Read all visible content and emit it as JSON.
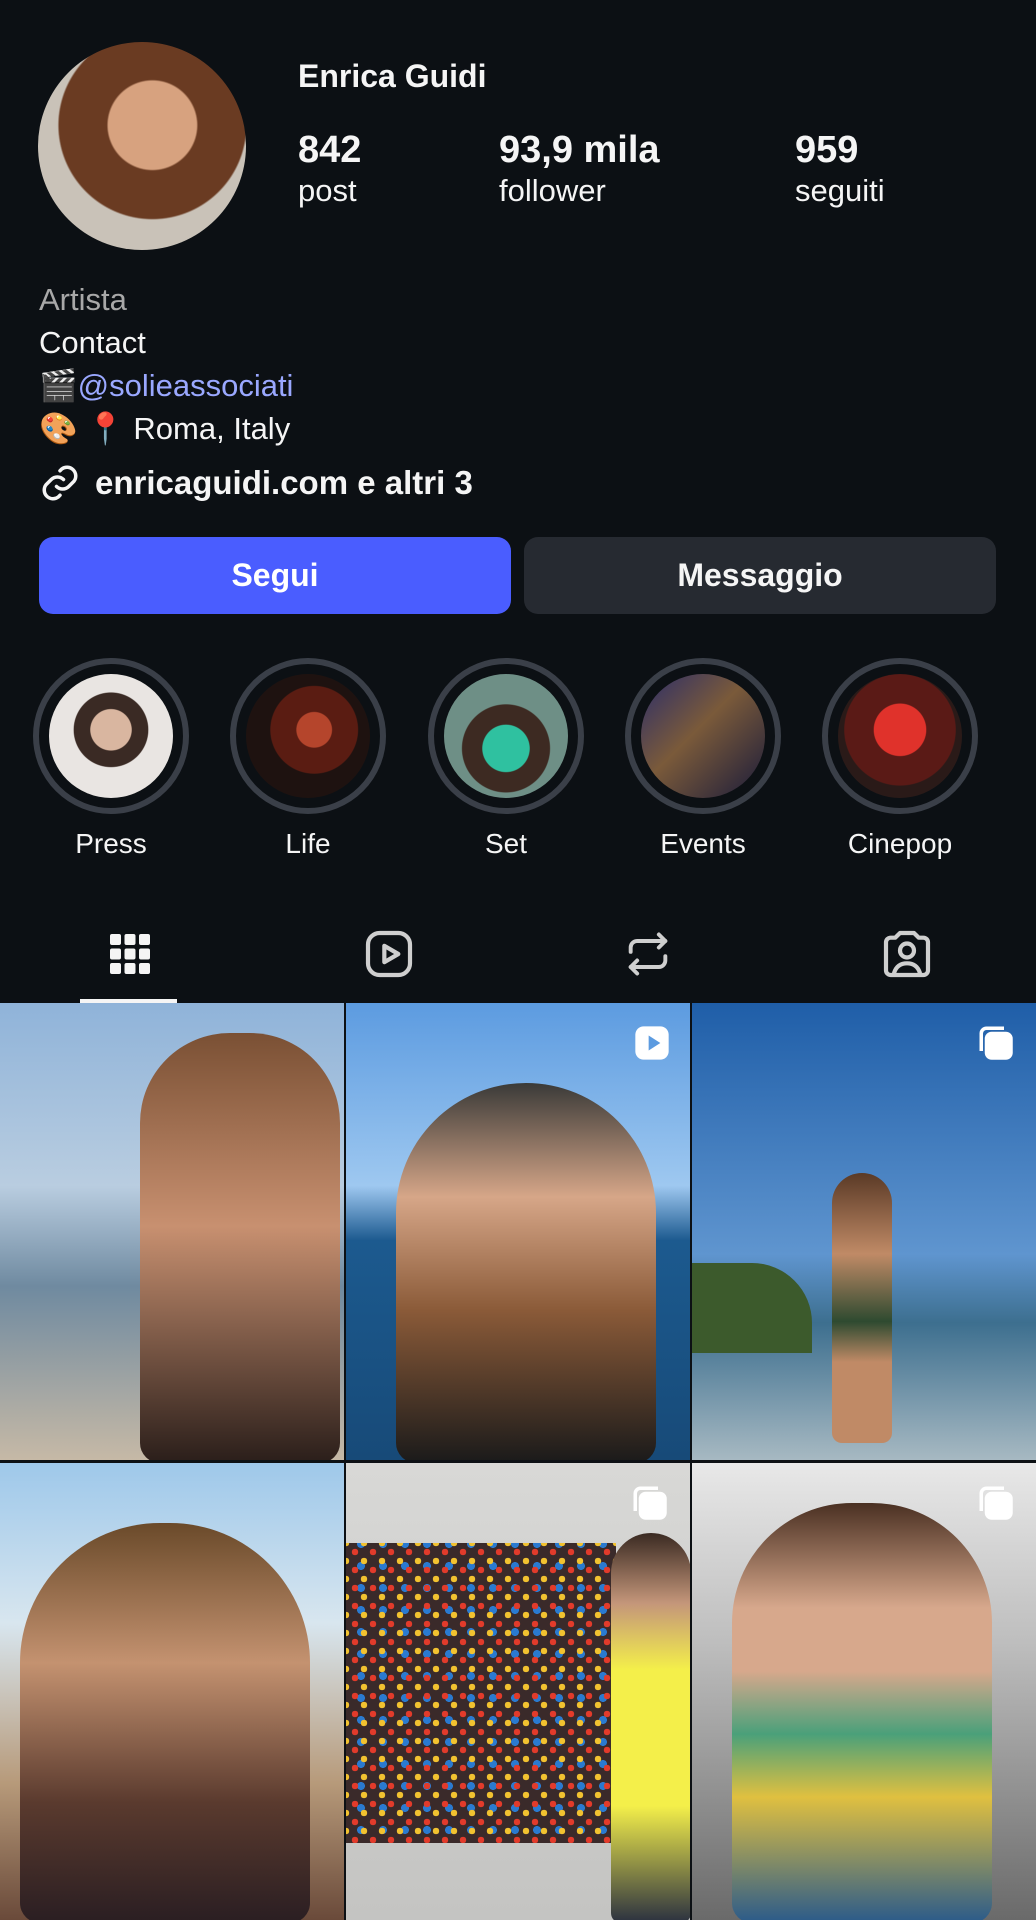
{
  "profile": {
    "name": "Enrica Guidi",
    "stats": [
      {
        "num": "842",
        "label": "post"
      },
      {
        "num": "93,9 mila",
        "label": "follower"
      },
      {
        "num": "959",
        "label": "seguiti"
      }
    ],
    "bio": {
      "category": "Artista",
      "line1": "Contact",
      "line2_emoji": "🎬",
      "line2_mention": "@solieassociati",
      "line3": "🎨 📍 Roma, Italy"
    },
    "link": "enricaguidi.com e altri 3"
  },
  "actions": {
    "follow": "Segui",
    "message": "Messaggio"
  },
  "highlights": [
    {
      "label": "Press"
    },
    {
      "label": "Life"
    },
    {
      "label": "Set"
    },
    {
      "label": "Events"
    },
    {
      "label": "Cinepop"
    }
  ],
  "tabs": [
    {
      "icon": "grid-icon",
      "active": true
    },
    {
      "icon": "reels-icon",
      "active": false
    },
    {
      "icon": "reposts-icon",
      "active": false
    },
    {
      "icon": "tagged-icon",
      "active": false
    }
  ],
  "colors": {
    "accent": "#4a5dff",
    "background": "#0c1014",
    "mention": "#9aa8ff"
  }
}
